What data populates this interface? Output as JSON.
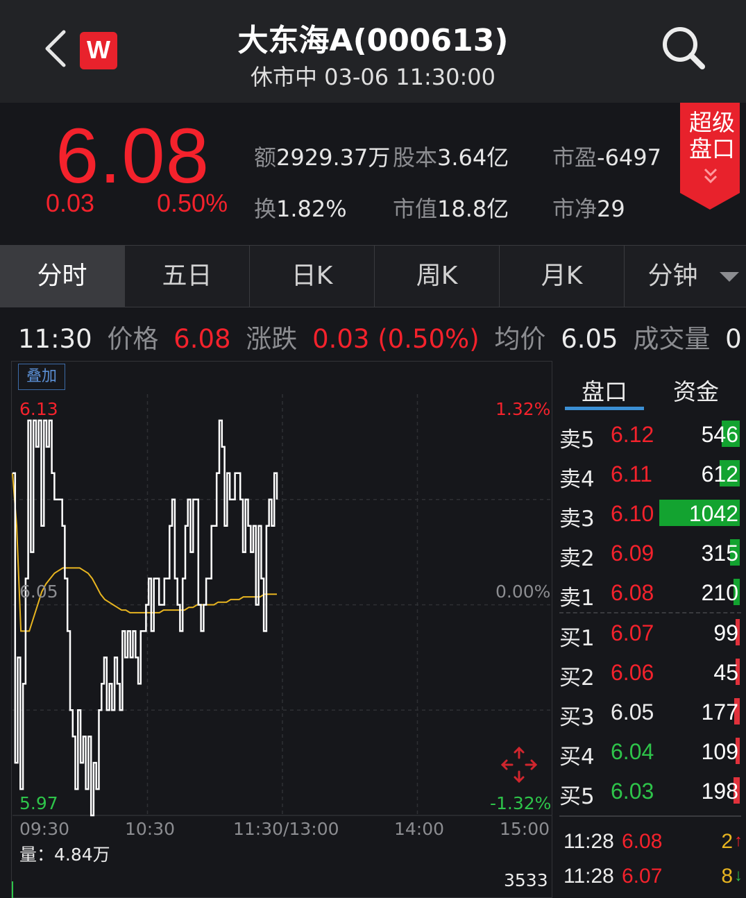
{
  "header": {
    "title": "大东海A(000613)",
    "subtitle": "休市中 03-06 11:30:00",
    "logo_text": "W"
  },
  "quote": {
    "price": "6.08",
    "change": "0.03",
    "change_pct": "0.50%",
    "stats": {
      "amount": {
        "label": "额",
        "value": "2929.37万"
      },
      "share_capital": {
        "label": "股本",
        "value": "3.64亿"
      },
      "pe": {
        "label": "市盈",
        "value": "-6497"
      },
      "turnover": {
        "label": "换",
        "value": "1.82%"
      },
      "market_cap": {
        "label": "市值",
        "value": "18.8亿"
      },
      "pb": {
        "label": "市净",
        "value": "29"
      }
    },
    "super_badge": "超级盘口"
  },
  "tabs": [
    {
      "label": "分时"
    },
    {
      "label": "五日"
    },
    {
      "label": "日K"
    },
    {
      "label": "周K"
    },
    {
      "label": "月K"
    },
    {
      "label": "分钟"
    }
  ],
  "info_line": {
    "time": "11:30",
    "price_label": "价格",
    "price": "6.08",
    "change_label": "涨跌",
    "change": "0.03 (0.50%)",
    "avg_label": "均价",
    "avg": "6.05",
    "volume_label": "成交量",
    "volume": "0"
  },
  "chart": {
    "overlay_btn": "叠加",
    "price_high": "6.13",
    "price_mid": "6.05",
    "price_low": "5.97",
    "pct_high": "1.32%",
    "pct_mid": "0.00%",
    "pct_low": "-1.32%",
    "time_labels": [
      "09:30",
      "10:30",
      "11:30/13:00",
      "14:00",
      "15:00"
    ],
    "volume_label": "量：4.84万",
    "volume_max": "3533"
  },
  "chart_data": {
    "type": "line",
    "ylim": [
      5.97,
      6.13
    ],
    "series": [
      {
        "name": "price",
        "color": "#ffffff",
        "values": [
          6.1,
          5.99,
          6.03,
          5.98,
          6.02,
          6.06,
          6.12,
          6.07,
          6.12,
          6.11,
          6.12,
          6.08,
          6.12,
          6.11,
          6.12,
          6.1,
          6.09,
          6.09,
          6.09,
          6.08,
          6.06,
          6.04,
          6.01,
          6.0,
          5.98,
          6.01,
          5.99,
          6.0,
          5.98,
          6.0,
          5.97,
          5.99,
          5.98,
          6.01,
          6.02,
          6.03,
          6.01,
          6.02,
          6.01,
          6.03,
          6.02,
          6.01,
          6.04,
          6.03,
          6.04,
          6.03,
          6.04,
          6.03,
          6.02,
          6.04,
          6.04,
          6.05,
          6.06,
          6.04,
          6.06,
          6.06,
          6.05,
          6.05,
          6.06,
          6.06,
          6.08,
          6.09,
          6.06,
          6.05,
          6.04,
          6.06,
          6.08,
          6.09,
          6.07,
          6.09,
          6.09,
          6.05,
          6.04,
          6.05,
          6.06,
          6.06,
          6.08,
          6.08,
          6.1,
          6.12,
          6.11,
          6.08,
          6.1,
          6.09,
          6.09,
          6.1,
          6.1,
          6.09,
          6.07,
          6.09,
          6.08,
          6.07,
          6.08,
          6.05,
          6.08,
          6.06,
          6.04,
          6.08,
          6.09,
          6.08,
          6.1,
          6.09
        ]
      },
      {
        "name": "average",
        "color": "#e8b520",
        "values": [
          6.1,
          6.08,
          6.04,
          6.04,
          6.04,
          6.045,
          6.05,
          6.055,
          6.058,
          6.06,
          6.062,
          6.063,
          6.064,
          6.064,
          6.064,
          6.064,
          6.064,
          6.063,
          6.062,
          6.06,
          6.057,
          6.054,
          6.052,
          6.051,
          6.05,
          6.049,
          6.048,
          6.048,
          6.047,
          6.047,
          6.047,
          6.047,
          6.047,
          6.047,
          6.047,
          6.047,
          6.048,
          6.048,
          6.048,
          6.048,
          6.048,
          6.048,
          6.049,
          6.049,
          6.05,
          6.05,
          6.05,
          6.05,
          6.05,
          6.051,
          6.051,
          6.051,
          6.052,
          6.052,
          6.052,
          6.053,
          6.053,
          6.053,
          6.053,
          6.053,
          6.054,
          6.054,
          6.054,
          6.054
        ]
      }
    ]
  },
  "orderbook": {
    "tab_active": "盘口",
    "tab_other": "资金",
    "asks": [
      {
        "label": "卖5",
        "price": "6.12",
        "vol": "546",
        "bar": 0.22,
        "price_color": "red"
      },
      {
        "label": "卖4",
        "price": "6.11",
        "vol": "612",
        "bar": 0.25,
        "price_color": "red"
      },
      {
        "label": "卖3",
        "price": "6.10",
        "vol": "1042",
        "bar": 1.0,
        "price_color": "red"
      },
      {
        "label": "卖2",
        "price": "6.09",
        "vol": "315",
        "bar": 0.12,
        "price_color": "red"
      },
      {
        "label": "卖1",
        "price": "6.08",
        "vol": "210",
        "bar": 0.08,
        "price_color": "red"
      }
    ],
    "bids": [
      {
        "label": "买1",
        "price": "6.07",
        "vol": "99",
        "bar": 0.03,
        "price_color": "red"
      },
      {
        "label": "买2",
        "price": "6.06",
        "vol": "45",
        "bar": 0.02,
        "price_color": "red"
      },
      {
        "label": "买3",
        "price": "6.05",
        "vol": "177",
        "bar": 0.07,
        "price_color": "white"
      },
      {
        "label": "买4",
        "price": "6.04",
        "vol": "109",
        "bar": 0.05,
        "price_color": "green"
      },
      {
        "label": "买5",
        "price": "6.03",
        "vol": "198",
        "bar": 0.08,
        "price_color": "green"
      }
    ],
    "ticks": [
      {
        "time": "11:28",
        "price": "6.08",
        "vol": "2",
        "arrow": "↑",
        "arrow_color": "#f4222c"
      },
      {
        "time": "11:28",
        "price": "6.07",
        "vol": "8",
        "arrow": "↓",
        "arrow_color": "#2ec44a"
      }
    ]
  },
  "colors": {
    "up": "#f4222c",
    "down": "#2ec44a",
    "avg": "#e8b520",
    "accent": "#3b8fd4"
  }
}
